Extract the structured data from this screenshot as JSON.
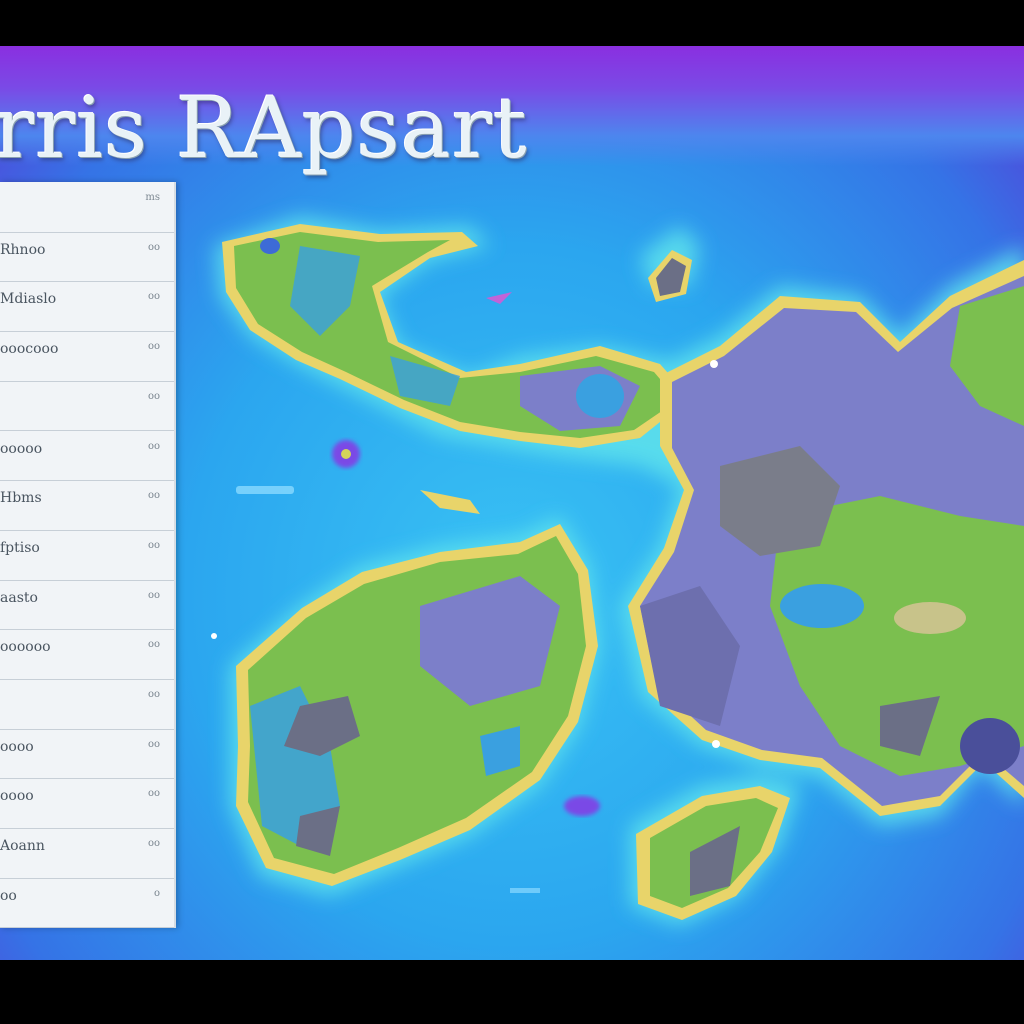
{
  "title": "rris RApsart",
  "legend": {
    "rows": [
      {
        "label": "",
        "value": "ms"
      },
      {
        "label": "Rhnoo",
        "value": "oo"
      },
      {
        "label": "Mdiaslo",
        "value": "oo"
      },
      {
        "label": "ooocooo",
        "value": "oo"
      },
      {
        "label": "",
        "value": "oo"
      },
      {
        "label": "ooooo",
        "value": "oo"
      },
      {
        "label": "Hbms",
        "value": "oo"
      },
      {
        "label": "fptiso",
        "value": "oo"
      },
      {
        "label": "aasto",
        "value": "oo"
      },
      {
        "label": "oooooo",
        "value": "oo"
      },
      {
        "label": "",
        "value": "oo"
      },
      {
        "label": "oooo",
        "value": "oo"
      },
      {
        "label": "oooo",
        "value": "oo"
      },
      {
        "label": "Aoann",
        "value": "oo"
      },
      {
        "label": "oo",
        "value": "o"
      }
    ]
  },
  "colors": {
    "ocean_deep": "#3573e6",
    "ocean_shallow": "#39c2f4",
    "coast_glow": "#5fe3ec",
    "shore": "#e8d46a",
    "land_green": "#7bbf4f",
    "land_purple": "#7c7fc9",
    "land_grey": "#7a7d8a",
    "lake": "#3aa0e0"
  }
}
